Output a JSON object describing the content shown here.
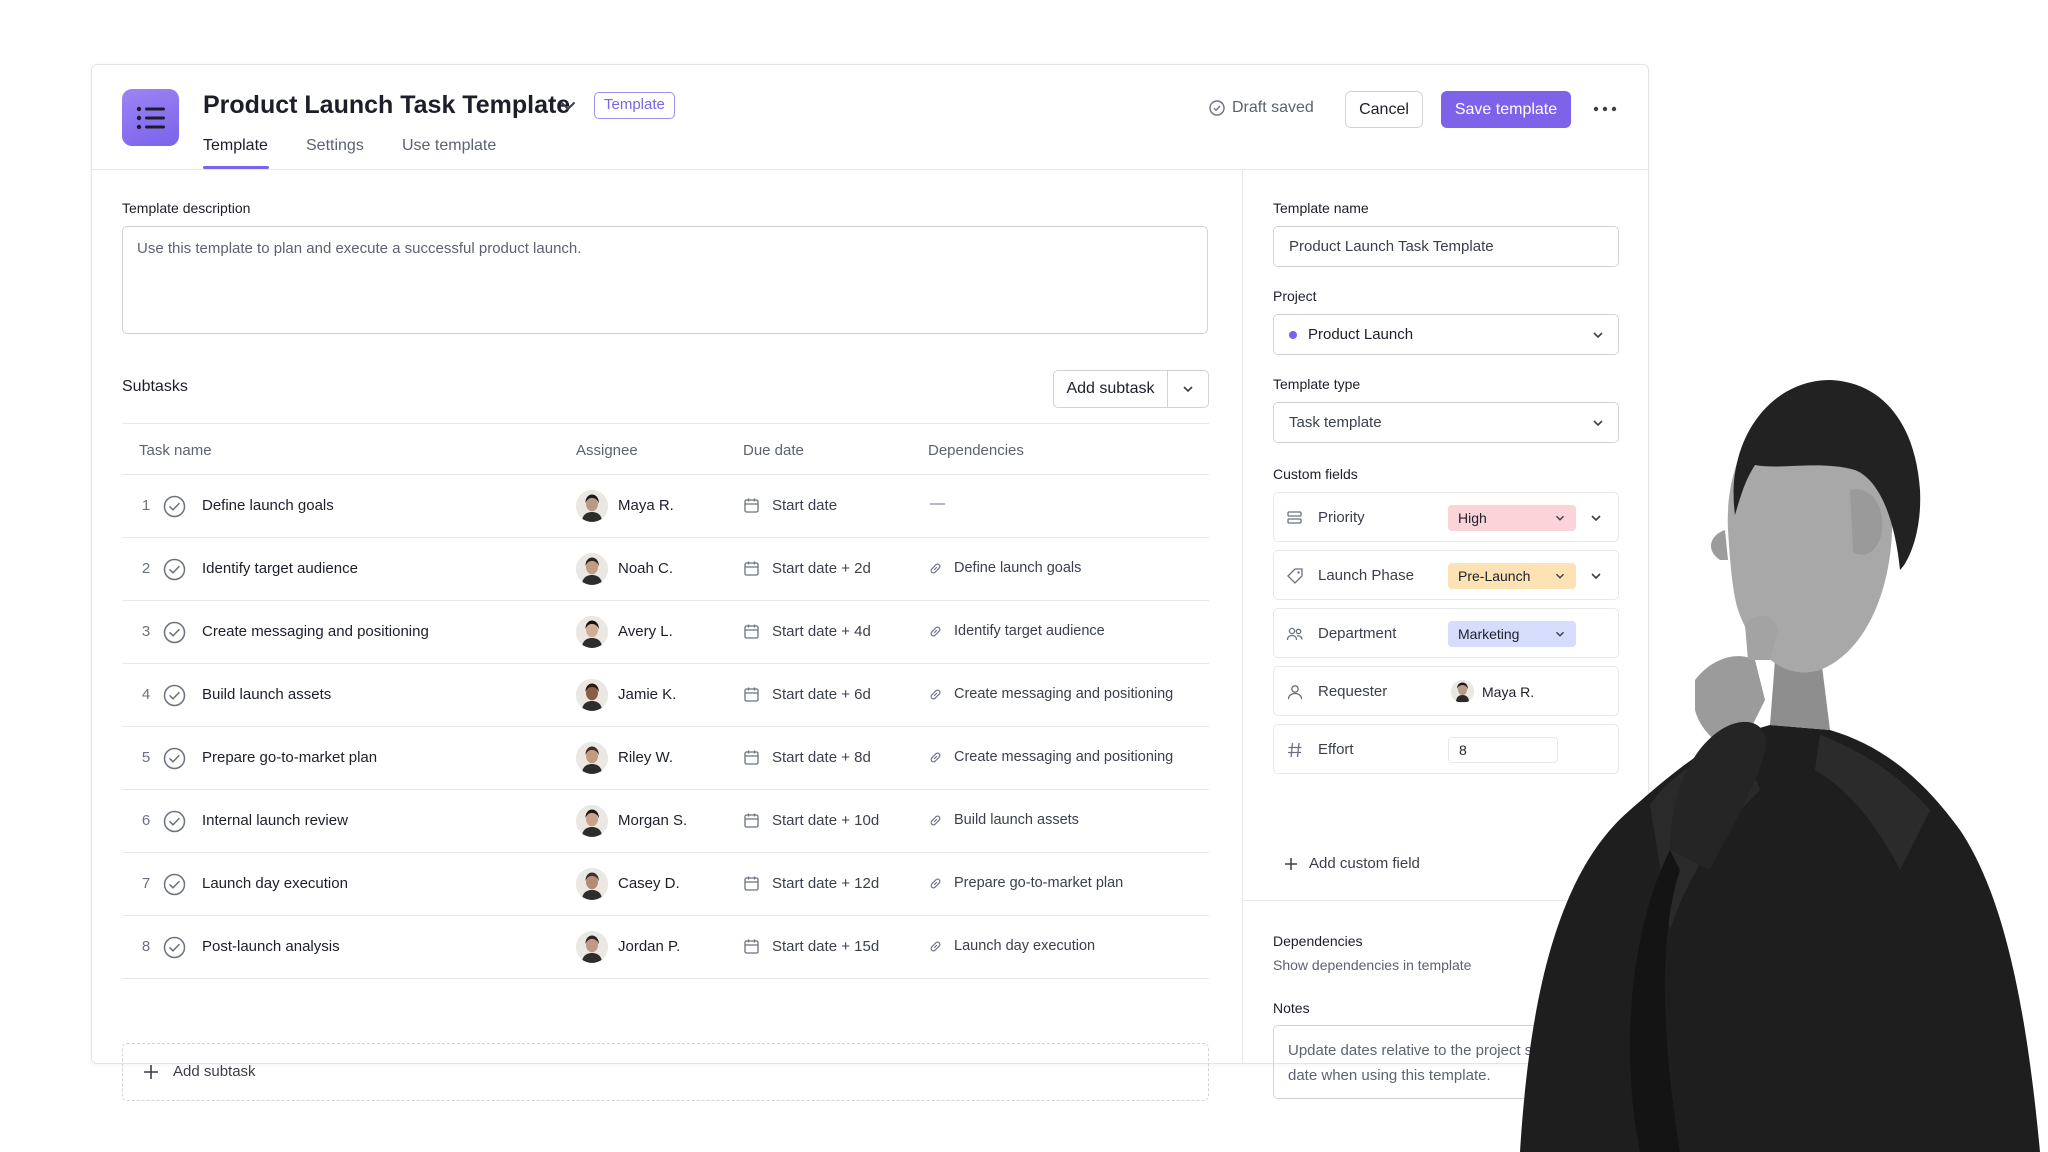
{
  "header": {
    "title": "Product Launch Task Template",
    "badge": "Template",
    "tabs": [
      {
        "label": "Template",
        "active": true
      },
      {
        "label": "Settings",
        "active": false
      },
      {
        "label": "Use template",
        "active": false
      }
    ],
    "draft_status": "Draft saved",
    "cancel_label": "Cancel",
    "save_label": "Save template"
  },
  "description": {
    "label": "Template description",
    "value": "Use this template to plan and execute a successful product launch."
  },
  "subtasks": {
    "label": "Subtasks",
    "add_button": "Add subtask",
    "columns": [
      "Task name",
      "Assignee",
      "Due date",
      "Dependencies"
    ],
    "rows": [
      {
        "num": "1",
        "name": "Define launch goals",
        "assignee": "Maya R.",
        "due": "Start date",
        "dependency": "—"
      },
      {
        "num": "2",
        "name": "Identify target audience",
        "assignee": "Noah C.",
        "due": "Start date + 2d",
        "dependency": "Define launch goals"
      },
      {
        "num": "3",
        "name": "Create messaging and positioning",
        "assignee": "Avery L.",
        "due": "Start date + 4d",
        "dependency": "Identify target audience"
      },
      {
        "num": "4",
        "name": "Build launch assets",
        "assignee": "Jamie K.",
        "due": "Start date + 6d",
        "dependency": "Create messaging and positioning"
      },
      {
        "num": "5",
        "name": "Prepare go-to-market plan",
        "assignee": "Riley W.",
        "due": "Start date + 8d",
        "dependency": "Create messaging and positioning"
      },
      {
        "num": "6",
        "name": "Internal launch review",
        "assignee": "Morgan S.",
        "due": "Start date + 10d",
        "dependency": "Build launch assets"
      },
      {
        "num": "7",
        "name": "Launch day execution",
        "assignee": "Casey D.",
        "due": "Start date + 12d",
        "dependency": "Prepare go-to-market plan"
      },
      {
        "num": "8",
        "name": "Post-launch analysis",
        "assignee": "Jordan P.",
        "due": "Start date + 15d",
        "dependency": "Launch day execution"
      }
    ],
    "add_row_label": "Add subtask"
  },
  "sidebar": {
    "template_name_label": "Template name",
    "template_name_value": "Product Launch Task Template",
    "project_label": "Project",
    "project_value": "Product Launch",
    "template_type_label": "Template type",
    "template_type_value": "Task template",
    "custom_fields_label": "Custom fields",
    "custom_fields": [
      {
        "name": "Priority",
        "value": "High",
        "color": "#fbd3d8",
        "icon": "priority-icon"
      },
      {
        "name": "Launch Phase",
        "value": "Pre-Launch",
        "color": "#fde2b3",
        "icon": "tag-icon"
      },
      {
        "name": "Department",
        "value": "Marketing",
        "color": "#d6dcfb",
        "icon": "people-icon"
      },
      {
        "name": "Requester",
        "value": "Maya R.",
        "icon": "person-icon"
      },
      {
        "name": "Effort",
        "value": "8",
        "icon": "hash-icon"
      }
    ],
    "add_custom_field": "Add custom field",
    "dependencies_label": "Dependencies",
    "dependencies_sub": "Show dependencies in template",
    "dependencies_on": true,
    "notes_label": "Notes",
    "notes_value": "Update dates relative to the project start date when using this template."
  },
  "colors": {
    "accent": "#7c63ea"
  }
}
